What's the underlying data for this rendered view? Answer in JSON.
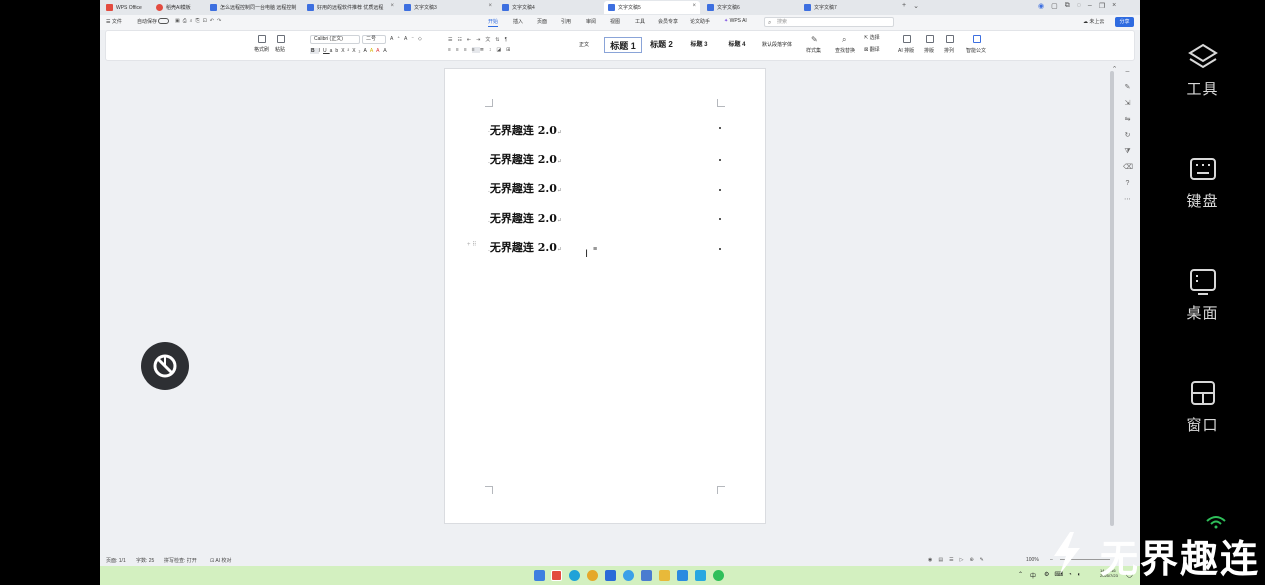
{
  "tabs": [
    {
      "label": "WPS Office",
      "color": "#e34b3f"
    },
    {
      "label": "稻壳AI模板",
      "color": "#e34b3f"
    },
    {
      "label": "怎么远程控制同一台电脑 远程控制",
      "color": "#3d6fe0"
    },
    {
      "label": "好用的远程软件推荐 优质远程",
      "color": "#3d6fe0"
    },
    {
      "label": "文字文稿3",
      "color": "#3d6fe0"
    },
    {
      "label": "文字文稿4",
      "color": "#3d6fe0"
    },
    {
      "label": "文字文稿5",
      "color": "#3d6fe0"
    },
    {
      "label": "文字文稿6",
      "color": "#3d6fe0"
    },
    {
      "label": "文字文稿7",
      "color": "#3d6fe0"
    }
  ],
  "menu": {
    "file": "文件",
    "autosave": "自动保存",
    "items": [
      "开始",
      "插入",
      "页面",
      "引用",
      "审阅",
      "视图",
      "工具",
      "会员专享",
      "论文助手",
      "WPS AI"
    ],
    "search_placeholder": "搜索",
    "cloud": "未上云",
    "share": "分享"
  },
  "ribbon": {
    "format_painter": "格式刷",
    "paste": "粘贴",
    "font_name": "Calibri (正文)",
    "font_size": "二号",
    "styles": [
      "正文",
      "标题 1",
      "标题 2",
      "标题 3",
      "标题 4",
      "默认段落字体"
    ],
    "style_set": "样式集",
    "find_replace": "查找替换",
    "select": "选择",
    "translate": "翻译",
    "ai_layout": "AI 排版",
    "layout": "排版",
    "arrange": "排列",
    "smart_doc": "智能公文"
  },
  "document": {
    "lines": [
      "无界趣连 2.0",
      "无界趣连 2.0",
      "无界趣连 2.0",
      "无界趣连 2.0",
      "无界趣连 2.0"
    ]
  },
  "status": {
    "page": "页面: 1/1",
    "words": "字数: 25",
    "spell": "拼写检查: 打开",
    "ai": "AI 校对",
    "zoom": "100%"
  },
  "tray": {
    "time": "14:48:16",
    "date": "2025/7/23",
    "ime": "中"
  },
  "right_panel": {
    "tools": "工具",
    "keyboard": "键盘",
    "desktop": "桌面",
    "window": "窗口"
  },
  "watermark": "无界趣连"
}
